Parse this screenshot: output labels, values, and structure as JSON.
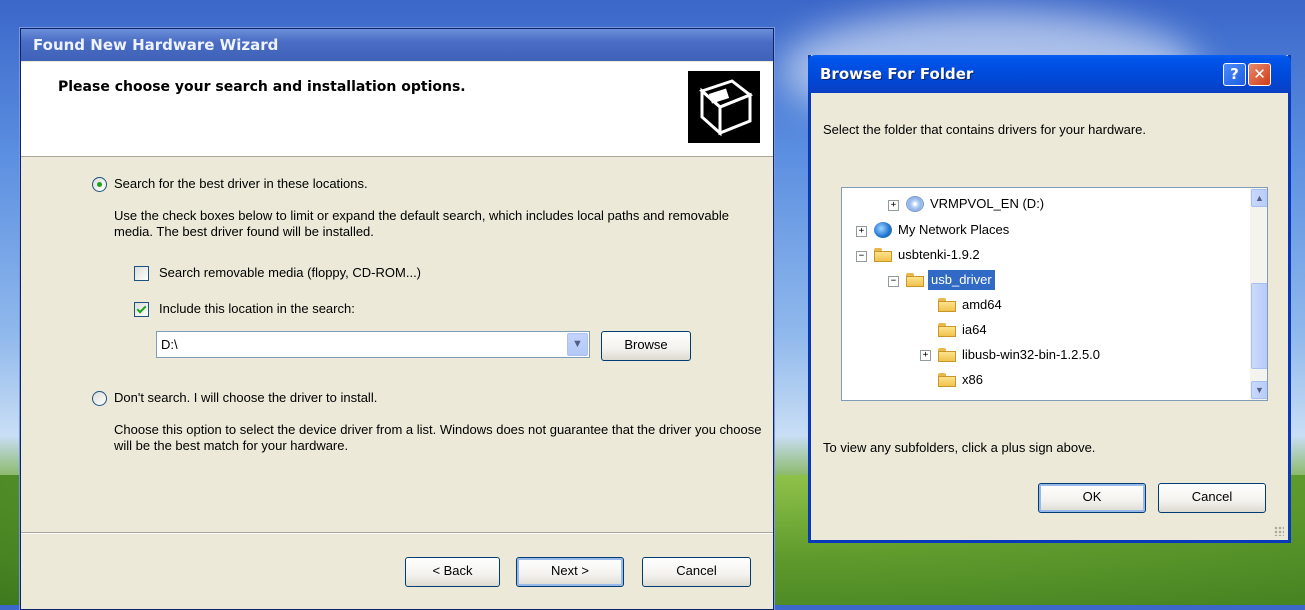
{
  "wizard": {
    "title": "Found New Hardware Wizard",
    "heading": "Please choose your search and installation options.",
    "option_search": {
      "label": "Search for the best driver in these locations.",
      "selected": true,
      "description": "Use the check boxes below to limit or expand the default search, which includes local paths and removable media. The best driver found will be installed."
    },
    "checkbox_removable": {
      "label": "Search removable media (floppy, CD-ROM...)",
      "checked": false
    },
    "checkbox_location": {
      "label": "Include this location in the search:",
      "checked": true
    },
    "location_value": "D:\\",
    "browse_label": "Browse",
    "option_manual": {
      "label": "Don't search. I will choose the driver to install.",
      "selected": false,
      "description": "Choose this option to select the device driver from a list.  Windows does not guarantee that the driver you choose will be the best match for your hardware."
    },
    "back_label": "< Back",
    "next_label": "Next >",
    "cancel_label": "Cancel"
  },
  "browse_dialog": {
    "title": "Browse For Folder",
    "help_glyph": "?",
    "close_glyph": "✕",
    "instruction": "Select the folder that contains drivers for your hardware.",
    "tree": [
      {
        "label": "VRMPVOL_EN (D:)",
        "icon": "cd-drive-icon",
        "expander": "+"
      },
      {
        "label": "My Network Places",
        "icon": "network-places-icon",
        "expander": "+"
      },
      {
        "label": "usbtenki-1.9.2",
        "icon": "folder-icon",
        "expander": "−"
      },
      {
        "label": "usb_driver",
        "icon": "folder-open-icon",
        "expander": "−",
        "selected": true
      },
      {
        "label": "amd64",
        "icon": "folder-icon"
      },
      {
        "label": "ia64",
        "icon": "folder-icon"
      },
      {
        "label": "libusb-win32-bin-1.2.5.0",
        "icon": "folder-icon",
        "expander": "+"
      },
      {
        "label": "x86",
        "icon": "folder-icon"
      }
    ],
    "hint": "To view any subfolders, click a plus sign above.",
    "ok_label": "OK",
    "cancel_label": "Cancel"
  },
  "colors": {
    "selection": "#316ac5",
    "title_blue": "#0048d8",
    "dialog_face": "#ece9d8"
  }
}
